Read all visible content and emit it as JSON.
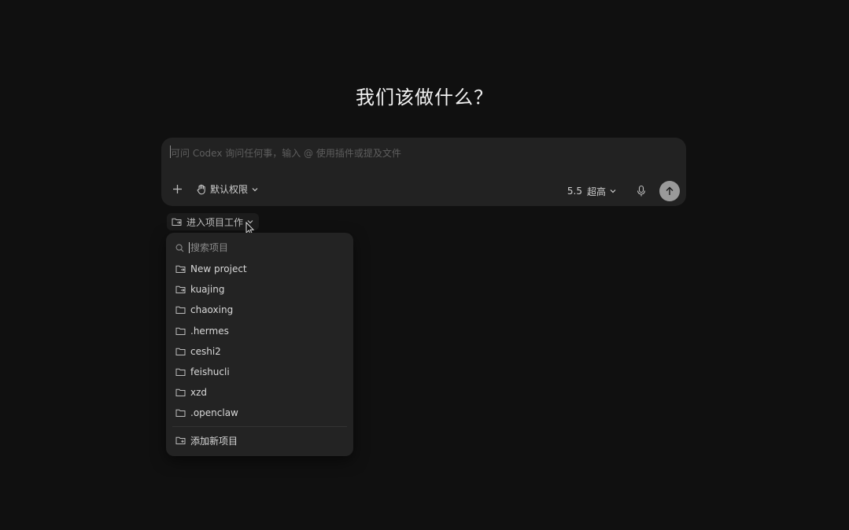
{
  "heading": "我们该做什么？",
  "composer": {
    "placeholder": "可问 Codex 询问任何事，输入 @ 使用插件或提及文件",
    "add_icon": "plus-icon",
    "permission_label": "默认权限",
    "model_version": "5.5",
    "model_level": "超高",
    "mic_icon": "microphone-icon",
    "send_icon": "arrow-up-icon"
  },
  "project_trigger": {
    "label": "进入项目工作"
  },
  "project_menu": {
    "search_placeholder": "搜索项目",
    "items": [
      {
        "label": "New project",
        "icon": "folder-arrow-icon"
      },
      {
        "label": "kuajing",
        "icon": "folder-arrow-icon"
      },
      {
        "label": "chaoxing",
        "icon": "folder-icon"
      },
      {
        "label": ".hermes",
        "icon": "folder-icon"
      },
      {
        "label": "ceshi2",
        "icon": "folder-icon"
      },
      {
        "label": "feishucli",
        "icon": "folder-icon"
      },
      {
        "label": "xzd",
        "icon": "folder-icon"
      },
      {
        "label": ".openclaw",
        "icon": "folder-icon"
      }
    ],
    "add_label": "添加新项目"
  },
  "colors": {
    "background": "#101010",
    "composer": "#222222",
    "menu": "#232323",
    "send_button": "#9a9a9a"
  }
}
